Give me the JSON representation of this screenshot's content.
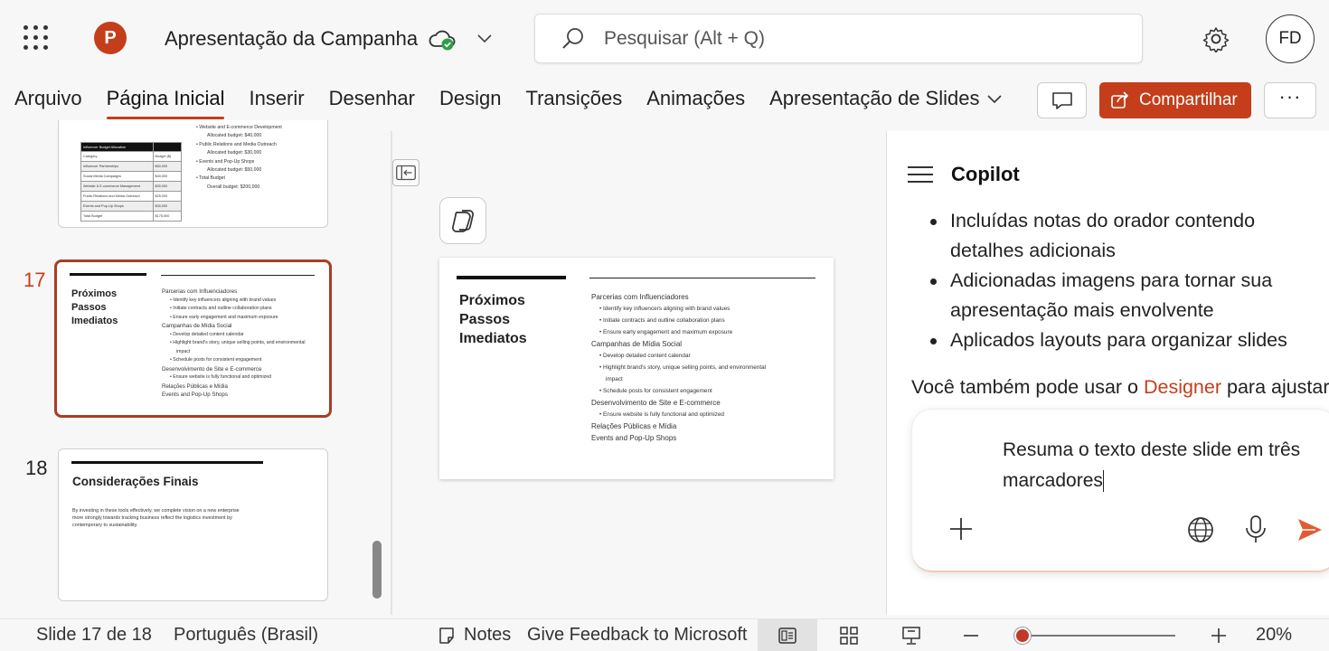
{
  "app": {
    "title": "Apresentação da Campanha",
    "logo_letter": "P"
  },
  "search": {
    "placeholder": "Pesquisar (Alt + Q)"
  },
  "user": {
    "initials": "FD"
  },
  "ribbon": {
    "tabs": [
      "Arquivo",
      "Página Inicial",
      "Inserir",
      "Desenhar",
      "Design",
      "Transições",
      "Animações",
      "Apresentação de Slides"
    ],
    "active_tab": "Página Inicial",
    "share_label": "Compartilhar",
    "more_label": "···"
  },
  "thumbnails": {
    "prev_table_rows": [
      [
        "Influencer Budget Allocation",
        ""
      ],
      [
        "Category",
        "Budget ($)"
      ],
      [
        "Influencer Partnerships",
        "$50,000"
      ],
      [
        "Social Media Campaigns",
        "$40,000"
      ],
      [
        "Website & E-commerce Management",
        "$30,000"
      ],
      [
        "Public Relations and Media Outreach",
        "$25,000"
      ],
      [
        "Events and Pop-Up Shops",
        "$30,000"
      ],
      [
        "Total Budget",
        "$175,000"
      ]
    ],
    "prev_bullets": [
      "Website and E-commerce Development",
      "Allocated budget: $40,000",
      "Public Relations and Media Outreach",
      "Allocated budget: $30,000",
      "Events and Pop-Up Shops",
      "Allocated budget: $50,000",
      "Total Budget",
      "Overall budget: $200,000"
    ],
    "slide17": {
      "number": "17",
      "title_lines": [
        "Próximos",
        "Passos",
        "Imediatos"
      ],
      "lines": [
        {
          "t": "Parcerias com Influenciadores",
          "sub": false
        },
        {
          "t": "Identify key influencers aligning with brand values",
          "sub": true
        },
        {
          "t": "Initiate contracts and outline collaboration plans",
          "sub": true
        },
        {
          "t": "Ensure early engagement and maximum exposure",
          "sub": true
        },
        {
          "t": "Campanhas de Mídia Social",
          "sub": false
        },
        {
          "t": "Develop detailed content calendar",
          "sub": true
        },
        {
          "t": "Highlight brand's story, unique selling points, and environmental",
          "sub": true
        },
        {
          "t": "impact",
          "sub": true,
          "cont": true
        },
        {
          "t": "Schedule posts for consistent engagement",
          "sub": true
        },
        {
          "t": "Desenvolvimento de Site e E-commerce",
          "sub": false
        },
        {
          "t": "Ensure website is fully functional and optimized",
          "sub": true
        },
        {
          "t": "Relações Públicas e Mídia",
          "sub": false
        },
        {
          "t": "Events and Pop-Up Shops",
          "sub": false
        }
      ]
    },
    "slide18": {
      "number": "18",
      "title": "Considerações Finais",
      "body": [
        "By investing in these tools effectively, we complete vision on a new enterprise",
        "more strongly towards tracking business reflect the logistics investment by",
        "contemporary to sustainability."
      ]
    }
  },
  "main_slide": {
    "title_lines": [
      "Próximos",
      "Passos",
      "Imediatos"
    ],
    "lines": [
      {
        "t": "Parcerias com Influenciadores",
        "sub": false
      },
      {
        "t": "Identify key influencers aligning with brand values",
        "sub": true
      },
      {
        "t": "Initiate contracts and outline collaboration plans",
        "sub": true
      },
      {
        "t": "Ensure early engagement and maximum exposure",
        "sub": true
      },
      {
        "t": "Campanhas de Mídia Social",
        "sub": false
      },
      {
        "t": "Develop detailed content calendar",
        "sub": true
      },
      {
        "t": "Highlight brand's story, unique selling points, and environmental",
        "sub": true
      },
      {
        "t": "impact",
        "sub": true,
        "cont": true
      },
      {
        "t": "Schedule posts for consistent engagement",
        "sub": true
      },
      {
        "t": "Desenvolvimento de Site e E-commerce",
        "sub": false
      },
      {
        "t": "Ensure website is fully functional and optimized",
        "sub": true
      },
      {
        "t": "Relações Públicas e Mídia",
        "sub": false
      },
      {
        "t": "Events and Pop-Up Shops",
        "sub": false
      }
    ]
  },
  "copilot": {
    "title": "Copilot",
    "bullets": [
      "Incluídas notas do orador contendo detalhes adicionais",
      "Adicionadas imagens para tornar sua apresentação mais envolvente",
      "Aplicados layouts para organizar slides"
    ],
    "also_prefix": "Você também pode usar o ",
    "also_link": "Designer",
    "also_suffix": " para ajustar",
    "input_text": "Resuma o texto deste slide em três marcadores"
  },
  "status": {
    "slide_pos": "Slide 17 de 18",
    "language": "Português (Brasil)",
    "notes": "Notes",
    "feedback": "Give Feedback to Microsoft",
    "zoom": "20%",
    "zoom_fraction": 0.05
  }
}
